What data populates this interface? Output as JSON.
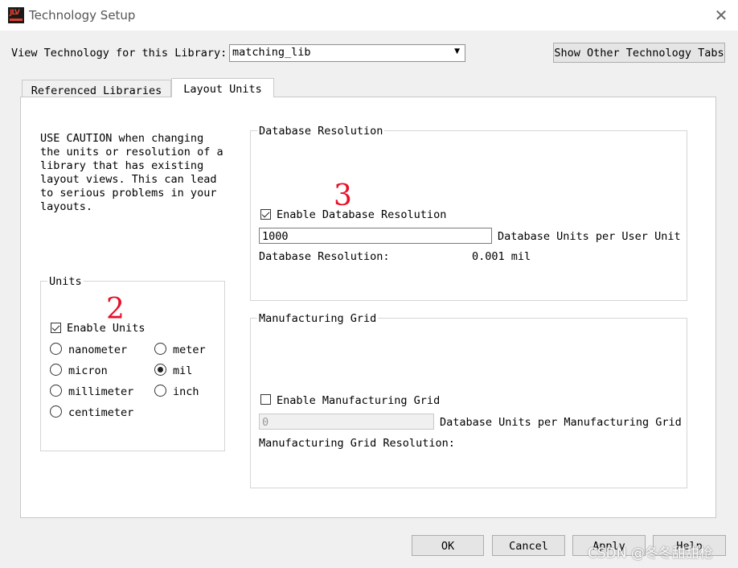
{
  "window": {
    "title": "Technology Setup",
    "icon_text": "JLV"
  },
  "library": {
    "label": "View Technology for this Library:",
    "value": "matching_lib",
    "show_tabs_label": "Show Other Technology Tabs"
  },
  "tabs": [
    {
      "label": "Referenced Libraries"
    },
    {
      "label": "Layout Units"
    }
  ],
  "caution_text": "USE CAUTION when changing\nthe units or resolution of a\nlibrary that has existing\nlayout views. This can lead\nto serious problems in your\nlayouts.",
  "units": {
    "title": "Units",
    "enable_label": "Enable Units",
    "enabled": true,
    "options": [
      {
        "label": "nanometer",
        "selected": false
      },
      {
        "label": "micron",
        "selected": false
      },
      {
        "label": "millimeter",
        "selected": false
      },
      {
        "label": "centimeter",
        "selected": false
      },
      {
        "label": "meter",
        "selected": false
      },
      {
        "label": "mil",
        "selected": true
      },
      {
        "label": "inch",
        "selected": false
      }
    ]
  },
  "db_resolution": {
    "title": "Database Resolution",
    "enable_label": "Enable Database Resolution",
    "enabled": true,
    "value": "1000",
    "units_label": "Database Units per User Unit",
    "resolution_label": "Database Resolution:",
    "resolution_value": "0.001 mil"
  },
  "mfg_grid": {
    "title": "Manufacturing Grid",
    "enable_label": "Enable Manufacturing Grid",
    "enabled": false,
    "value": "0",
    "units_label": "Database Units per Manufacturing Grid",
    "resolution_label": "Manufacturing Grid Resolution:"
  },
  "annotations": {
    "units": "2",
    "db": "3"
  },
  "buttons": {
    "ok": "OK",
    "cancel": "Cancel",
    "apply": "Apply",
    "help": "Help"
  },
  "watermark": "CSDN @冬冬甜甜枪",
  "colors": {
    "annotation": "#e8102a"
  }
}
